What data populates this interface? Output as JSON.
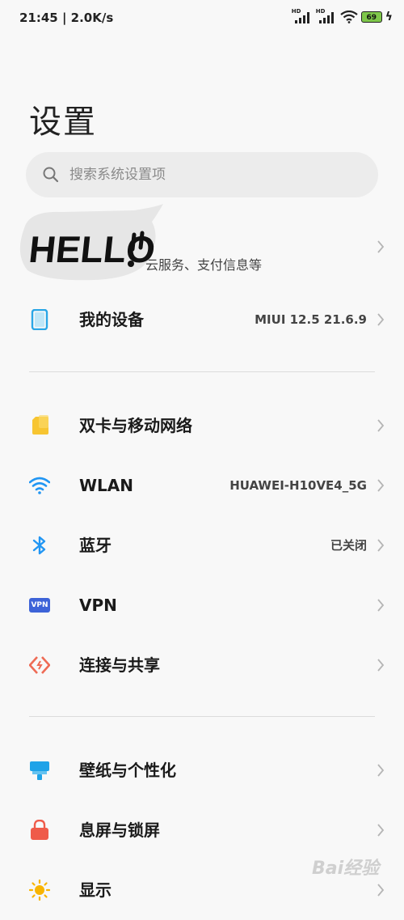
{
  "status": {
    "time_speed": "21:45 | 2.0K/s",
    "signal1_label": "HD",
    "signal2_label": "HD",
    "battery_level": "69"
  },
  "header": {
    "title": "设置"
  },
  "search": {
    "placeholder": "搜索系统设置项"
  },
  "account": {
    "sticker_text": "HELLO",
    "subtitle": "云服务、支付信息等"
  },
  "rows": {
    "device": {
      "label": "我的设备",
      "value": "MIUI 12.5 21.6.9"
    },
    "sim": {
      "label": "双卡与移动网络",
      "value": ""
    },
    "wlan": {
      "label": "WLAN",
      "value": "HUAWEI-H10VE4_5G"
    },
    "bluetooth": {
      "label": "蓝牙",
      "value": "已关闭"
    },
    "vpn": {
      "label": "VPN",
      "value": "",
      "icon_text": "VPN"
    },
    "sharing": {
      "label": "连接与共享",
      "value": ""
    },
    "wallpaper": {
      "label": "壁纸与个性化",
      "value": ""
    },
    "lockscreen": {
      "label": "息屏与锁屏",
      "value": ""
    },
    "display": {
      "label": "显示",
      "value": ""
    }
  },
  "watermark": {
    "text": "Bai经验"
  },
  "colors": {
    "device_icon": "#2aa6e6",
    "sim_icon": "#f7c531",
    "wlan_icon": "#2196f3",
    "bluetooth_icon": "#2196f3",
    "vpn_icon": "#3d63d8",
    "sharing_icon": "#ee6b55",
    "wallpaper_icon": "#1fa3e8",
    "lock_icon": "#ef5b4a",
    "display_icon": "#f8b400"
  }
}
